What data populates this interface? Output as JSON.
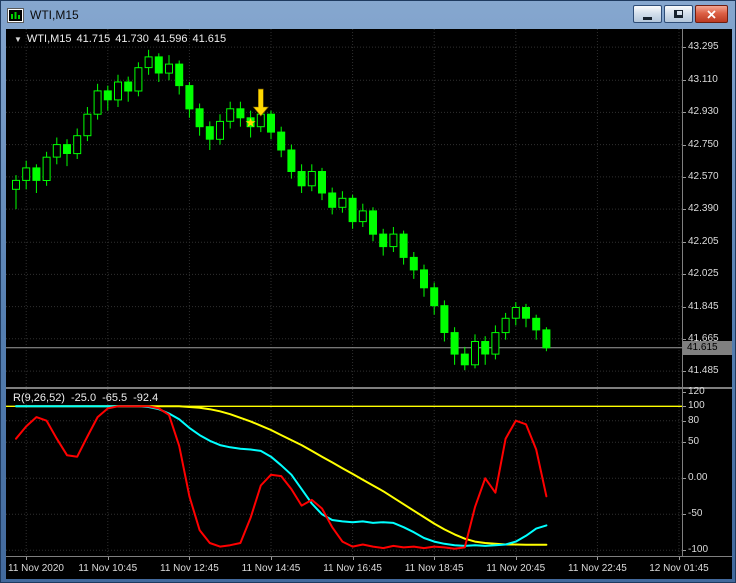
{
  "window": {
    "title": "WTI,M15",
    "icon": "chart-window-icon",
    "controls": [
      {
        "name": "minimize",
        "icon": "minimize-icon"
      },
      {
        "name": "restore",
        "icon": "restore-icon"
      },
      {
        "name": "close",
        "icon": "close-icon"
      }
    ]
  },
  "chart_header": {
    "collapse_glyph": "▼",
    "symbol": "WTI,M15",
    "open": "41.715",
    "high": "41.730",
    "low": "41.596",
    "close": "41.615"
  },
  "indicator_header": {
    "name": "R(9,26,52)",
    "values": [
      "-25.0",
      "-65.5",
      "-92.4"
    ]
  },
  "price_axis": {
    "labels": [
      "43.295",
      "43.110",
      "42.930",
      "42.750",
      "42.570",
      "42.390",
      "42.205",
      "42.025",
      "41.845",
      "41.665",
      "41.485"
    ],
    "current_price": "41.615"
  },
  "indicator_axis": {
    "labels": [
      "120",
      "100",
      "80",
      "50",
      "0.00",
      "-50",
      "-100"
    ],
    "values": [
      120,
      100,
      80,
      50,
      0,
      -50,
      -100
    ]
  },
  "time_axis": {
    "ticks": [
      {
        "index": 1,
        "label": "11 Nov 2020"
      },
      {
        "index": 9,
        "label": "11 Nov 10:45"
      },
      {
        "index": 17,
        "label": "11 Nov 12:45"
      },
      {
        "index": 25,
        "label": "11 Nov 14:45"
      },
      {
        "index": 33,
        "label": "11 Nov 16:45"
      },
      {
        "index": 41,
        "label": "11 Nov 18:45"
      },
      {
        "index": 49,
        "label": "11 Nov 20:45"
      },
      {
        "index": 57,
        "label": "11 Nov 22:45"
      },
      {
        "index": 65,
        "label": "12 Nov 01:45"
      }
    ]
  },
  "colors": {
    "background": "#000000",
    "grid": "#303030",
    "bull": "#000000",
    "bear": "#00ff00",
    "candle_outline": "#00ff00",
    "price_line": "#9e9e9e",
    "axis_text": "#dcdcdc",
    "annotation": "#ffd800"
  },
  "chart_data": {
    "type": "candlestick",
    "title": "WTI,M15",
    "timeframe": "M15",
    "ylim": [
      41.396,
      43.396
    ],
    "grid": true,
    "price_gridlines": [
      43.295,
      43.11,
      42.93,
      42.75,
      42.57,
      42.39,
      42.205,
      42.025,
      41.845,
      41.665,
      41.485
    ],
    "current_price": 41.615,
    "candles_ohlc": [
      [
        42.5,
        42.58,
        42.39,
        42.55
      ],
      [
        42.55,
        42.66,
        42.5,
        42.62
      ],
      [
        42.62,
        42.64,
        42.48,
        42.55
      ],
      [
        42.55,
        42.71,
        42.52,
        42.68
      ],
      [
        42.68,
        42.79,
        42.64,
        42.75
      ],
      [
        42.75,
        42.78,
        42.63,
        42.7
      ],
      [
        42.7,
        42.84,
        42.67,
        42.8
      ],
      [
        42.8,
        42.96,
        42.77,
        42.92
      ],
      [
        42.92,
        43.09,
        42.89,
        43.05
      ],
      [
        43.05,
        43.08,
        42.94,
        43.0
      ],
      [
        43.0,
        43.14,
        42.96,
        43.1
      ],
      [
        43.1,
        43.13,
        42.99,
        43.05
      ],
      [
        43.05,
        43.21,
        43.02,
        43.18
      ],
      [
        43.18,
        43.28,
        43.14,
        43.24
      ],
      [
        43.24,
        43.26,
        43.1,
        43.15
      ],
      [
        43.15,
        43.25,
        43.11,
        43.2
      ],
      [
        43.2,
        43.22,
        43.03,
        43.08
      ],
      [
        43.08,
        43.1,
        42.9,
        42.95
      ],
      [
        42.95,
        42.98,
        42.8,
        42.85
      ],
      [
        42.85,
        42.88,
        42.72,
        42.78
      ],
      [
        42.78,
        42.92,
        42.75,
        42.88
      ],
      [
        42.88,
        42.99,
        42.84,
        42.95
      ],
      [
        42.95,
        42.99,
        42.85,
        42.9
      ],
      [
        42.9,
        42.94,
        42.79,
        42.85
      ],
      [
        42.85,
        42.96,
        42.82,
        42.92
      ],
      [
        42.92,
        42.94,
        42.78,
        42.82
      ],
      [
        42.82,
        42.85,
        42.68,
        42.72
      ],
      [
        42.72,
        42.75,
        42.56,
        42.6
      ],
      [
        42.6,
        42.64,
        42.48,
        42.52
      ],
      [
        42.52,
        42.64,
        42.49,
        42.6
      ],
      [
        42.6,
        42.62,
        42.44,
        42.48
      ],
      [
        42.48,
        42.51,
        42.36,
        42.4
      ],
      [
        42.4,
        42.49,
        42.37,
        42.45
      ],
      [
        42.45,
        42.47,
        42.28,
        42.32
      ],
      [
        42.32,
        42.42,
        42.29,
        42.38
      ],
      [
        42.38,
        42.4,
        42.21,
        42.25
      ],
      [
        42.25,
        42.28,
        42.13,
        42.18
      ],
      [
        42.18,
        42.29,
        42.15,
        42.25
      ],
      [
        42.25,
        42.27,
        42.08,
        42.12
      ],
      [
        42.12,
        42.15,
        42.0,
        42.05
      ],
      [
        42.05,
        42.08,
        41.9,
        41.95
      ],
      [
        41.95,
        41.98,
        41.8,
        41.85
      ],
      [
        41.85,
        41.88,
        41.65,
        41.7
      ],
      [
        41.7,
        41.73,
        41.52,
        41.58
      ],
      [
        41.58,
        41.62,
        41.49,
        41.52
      ],
      [
        41.52,
        41.69,
        41.5,
        41.65
      ],
      [
        41.65,
        41.68,
        41.52,
        41.58
      ],
      [
        41.58,
        41.74,
        41.55,
        41.7
      ],
      [
        41.7,
        41.81,
        41.66,
        41.78
      ],
      [
        41.78,
        41.87,
        41.74,
        41.84
      ],
      [
        41.84,
        41.86,
        41.73,
        41.78
      ],
      [
        41.78,
        41.8,
        41.66,
        41.715
      ],
      [
        41.715,
        41.73,
        41.596,
        41.615
      ]
    ],
    "annotations": [
      {
        "type": "star",
        "glyph": "★",
        "index": 23,
        "price": 42.87,
        "color": "#ffd800"
      },
      {
        "type": "arrow-down",
        "index": 24,
        "price_tip": 42.91,
        "price_tail": 43.06,
        "color": "#ffd800"
      }
    ],
    "indicator": {
      "type": "line",
      "name": "R(9,26,52)",
      "ylim": [
        -108,
        124
      ],
      "levels": [
        {
          "value": 100,
          "color": "#ffff00"
        }
      ],
      "gridline_values": [
        80,
        50,
        0,
        -50,
        -100
      ],
      "series": [
        {
          "name": "R9",
          "color": "#ff0000",
          "last_value": -25.0,
          "values": [
            55,
            72,
            85,
            80,
            55,
            32,
            30,
            58,
            85,
            97,
            100,
            100,
            100,
            100,
            97,
            88,
            45,
            -25,
            -72,
            -90,
            -95,
            -93,
            -90,
            -55,
            -10,
            5,
            3,
            -15,
            -38,
            -30,
            -42,
            -68,
            -88,
            -95,
            -92,
            -95,
            -97,
            -94,
            -96,
            -95,
            -97,
            -95,
            -96,
            -98,
            -96,
            -40,
            0,
            -20,
            55,
            80,
            75,
            40,
            -25
          ]
        },
        {
          "name": "R26",
          "color": "#00ffff",
          "last_value": -65.5,
          "values": [
            100,
            100,
            100,
            100,
            100,
            100,
            100,
            100,
            100,
            100,
            100,
            100,
            100,
            99,
            96,
            90,
            82,
            70,
            60,
            52,
            46,
            43,
            41,
            40,
            38,
            30,
            18,
            5,
            -15,
            -35,
            -50,
            -58,
            -60,
            -61,
            -60,
            -62,
            -61,
            -62,
            -68,
            -75,
            -83,
            -88,
            -91,
            -93,
            -94,
            -93,
            -94,
            -93,
            -92,
            -88,
            -80,
            -70,
            -65.5
          ]
        },
        {
          "name": "R52",
          "color": "#ffff00",
          "last_value": -92.4,
          "values": [
            100,
            100,
            100,
            100,
            100,
            100,
            100,
            100,
            100,
            100,
            100,
            100,
            100,
            100,
            100,
            100,
            100,
            99,
            98,
            96,
            93,
            89,
            84,
            79,
            73,
            67,
            60,
            53,
            46,
            38,
            30,
            22,
            14,
            6,
            -2,
            -10,
            -18,
            -27,
            -36,
            -45,
            -54,
            -63,
            -71,
            -78,
            -84,
            -88,
            -90,
            -91,
            -92,
            -92,
            -92.4,
            -92.4,
            -92.4
          ]
        }
      ]
    }
  }
}
